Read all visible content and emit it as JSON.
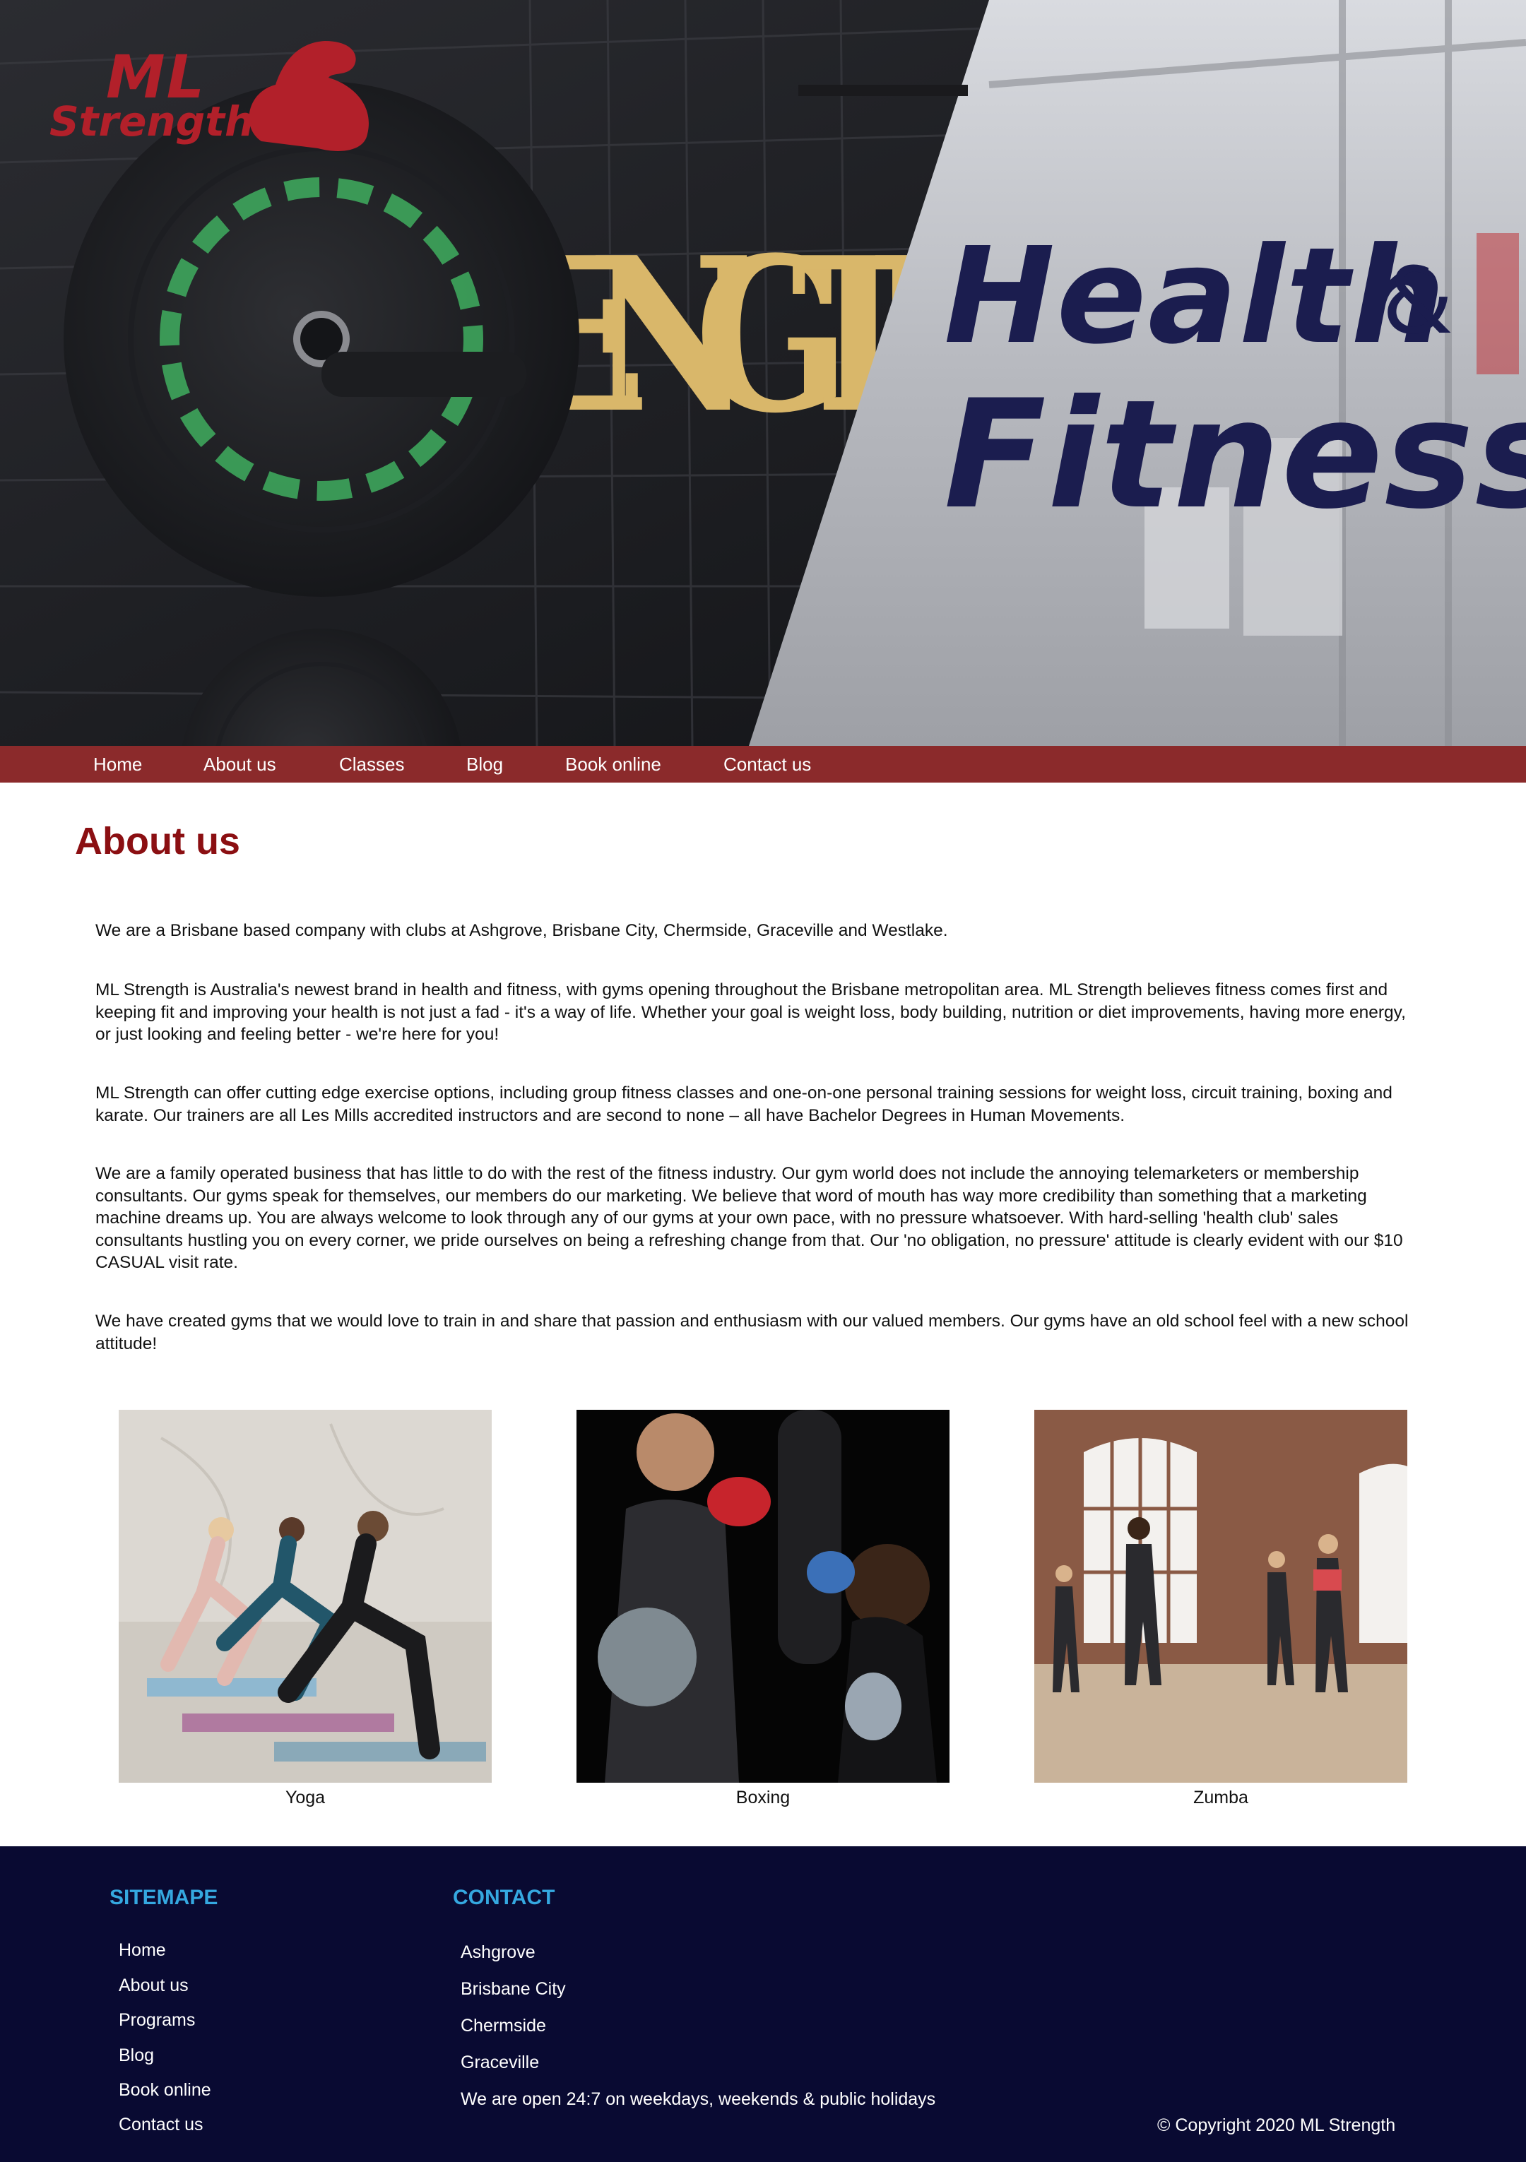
{
  "brand": {
    "logo_line1": "ML",
    "logo_line2": "Strength",
    "logo_color": "#b2202a"
  },
  "hero": {
    "title_line1": "Health",
    "ampersand": "&",
    "title_line2": "Fitness",
    "title_color": "#1b1d4f"
  },
  "nav": {
    "background": "#8b2a2b",
    "items": [
      "Home",
      "About us",
      "Classes",
      "Blog",
      "Book online",
      "Contact us"
    ]
  },
  "main": {
    "title": "About us",
    "paragraphs": [
      "We are a Brisbane based company with clubs at Ashgrove, Brisbane City, Chermside, Graceville and Westlake.",
      "ML Strength is Australia's newest brand in health and fitness, with gyms opening throughout the Brisbane metropolitan area. ML Strength believes fitness comes first and keeping fit and improving your health is not just a fad - it's a way of life. Whether your goal is weight loss, body building, nutrition or diet improvements, having more energy, or just looking and feeling better - we're here for you!",
      "ML Strength can offer cutting edge exercise options, including group fitness classes and one-on-one personal training sessions for weight loss, circuit training, boxing and karate. Our trainers are all Les Mills accredited instructors and are second to none – all have Bachelor Degrees in Human Movements.",
      "We are a family operated business that has little to do with the rest of the fitness industry. Our gym world does not include the annoying telemarketers or membership consultants. Our gyms speak for themselves, our members do our marketing. We believe that word of mouth has way more credibility than something that a marketing machine dreams up. You are always welcome to look through any of our gyms at your own pace, with no pressure whatsoever. With hard-selling 'health club' sales consultants hustling you on every corner, we pride ourselves on being a refreshing change from that. Our 'no obligation, no pressure' attitude is clearly evident with our $10 CASUAL visit rate.",
      "We have created gyms that we would love to train in and share that passion and enthusiasm with our valued members. Our gyms have an old school feel with a new school attitude!"
    ],
    "classes": [
      {
        "caption": "Yoga"
      },
      {
        "caption": "Boxing"
      },
      {
        "caption": "Zumba"
      }
    ]
  },
  "footer": {
    "background": "#090a32",
    "sitemap_title": "SITEMAPE",
    "sitemap_links": [
      "Home",
      "About us",
      "Programs",
      "Blog",
      "Book online",
      "Contact us"
    ],
    "contact_title": "CONTACT",
    "contact_items": [
      "Ashgrove",
      "Brisbane City",
      "Chermside",
      "Graceville",
      "We are open 24:7 on weekdays, weekends & public holidays"
    ],
    "copyright": "© Copyright 2020 ML Strength"
  }
}
